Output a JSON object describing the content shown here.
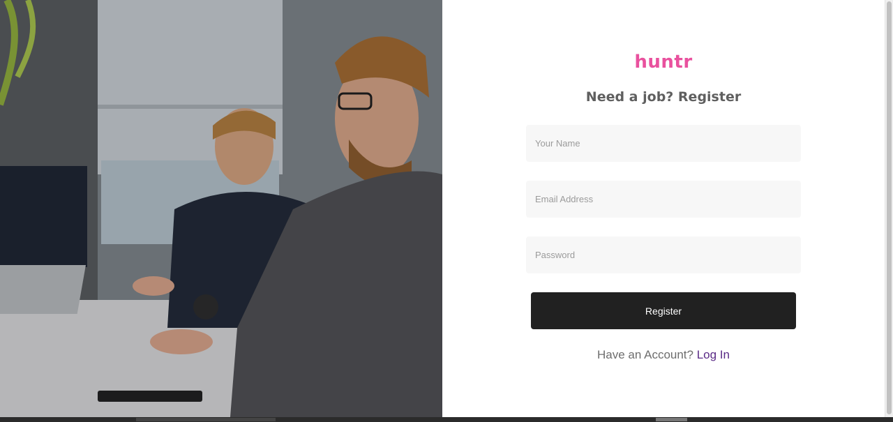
{
  "brand": {
    "name": "huntr",
    "color": "#e9519e"
  },
  "form": {
    "heading": "Need a job? Register",
    "name_placeholder": "Your Name",
    "email_placeholder": "Email Address",
    "password_placeholder": "Password",
    "submit_label": "Register"
  },
  "footer": {
    "prompt": "Have an Account? ",
    "login_label": "Log In",
    "link_color": "#5a2a86"
  },
  "hero": {
    "image_icon": "office-photo"
  }
}
